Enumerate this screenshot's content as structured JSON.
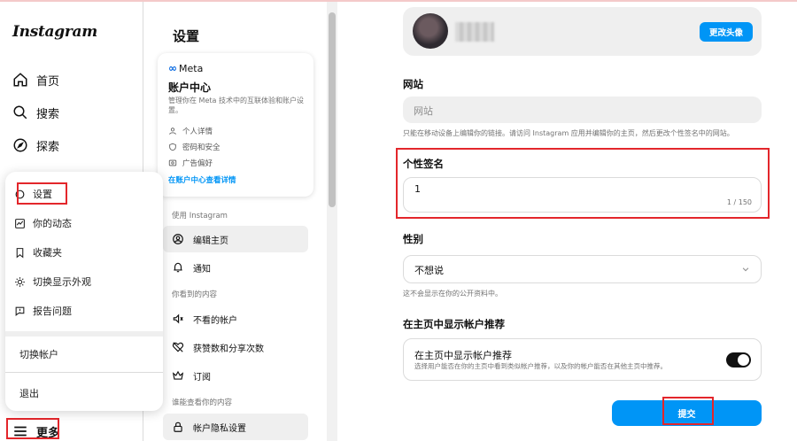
{
  "nav": {
    "logo": "Instagram",
    "items": [
      {
        "label": "首页",
        "icon": "home-icon"
      },
      {
        "label": "搜索",
        "icon": "search-icon"
      },
      {
        "label": "探索",
        "icon": "compass-icon"
      }
    ],
    "more_label": "更多"
  },
  "popup_menu": {
    "items": [
      {
        "label": "设置",
        "icon": "settings-icon"
      },
      {
        "label": "你的动态",
        "icon": "activity-icon"
      },
      {
        "label": "收藏夹",
        "icon": "bookmark-icon"
      },
      {
        "label": "切换显示外观",
        "icon": "sun-icon"
      },
      {
        "label": "报告问题",
        "icon": "report-icon"
      }
    ],
    "switch_account": "切换帐户",
    "logout": "退出"
  },
  "settings": {
    "title": "设置",
    "meta_card": {
      "brand": "Meta",
      "heading": "账户中心",
      "description": "管理你在 Meta 技术中的互联体验和账户设置。",
      "rows": [
        {
          "label": "个人详情",
          "icon": "person-icon"
        },
        {
          "label": "密码和安全",
          "icon": "shield-icon"
        },
        {
          "label": "广告偏好",
          "icon": "ad-icon"
        }
      ],
      "link": "在账户中心查看详情"
    },
    "section_use": "使用 Instagram",
    "edit_profile": "编辑主页",
    "notifications": "通知",
    "section_seen": "你看到的内容",
    "not_seen": "不看的帐户",
    "likes_shares": "获赞数和分享次数",
    "subscriptions": "订阅",
    "section_who": "谁能查看你的内容",
    "privacy": "帐户隐私设置"
  },
  "main": {
    "change_avatar": "更改头像",
    "website_label": "网站",
    "website_placeholder": "网站",
    "website_helper": "只能在移动设备上编辑你的链接。请访问 Instagram 应用并编辑你的主页，然后更改个性签名中的网站。",
    "bio_label": "个性签名",
    "bio_value": "1",
    "bio_count": "1 / 150",
    "gender_label": "性别",
    "gender_value": "不想说",
    "gender_helper": "这不会显示在你的公开资料中。",
    "rec_section_label": "在主页中显示帐户推荐",
    "rec_title": "在主页中显示帐户推荐",
    "rec_desc": "选择用户能否在你的主页中看到类似帐户推荐，以及你的帐户能否在其他主页中推荐。",
    "rec_enabled": true,
    "submit": "提交"
  },
  "colors": {
    "accent": "#0095f6",
    "highlight_box": "#e3262b",
    "meta_blue": "#0668e1"
  }
}
